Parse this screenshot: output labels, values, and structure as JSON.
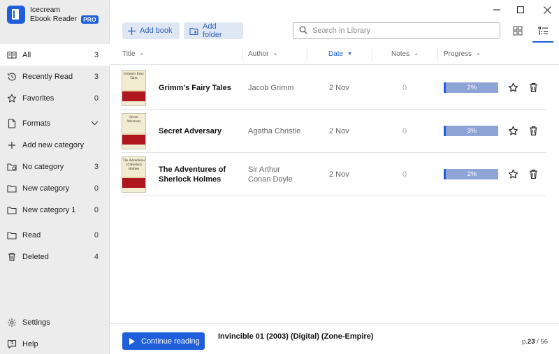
{
  "app": {
    "name_line1": "Icecream",
    "name_line2": "Ebook Reader",
    "badge": "PRO",
    "accent_color": "#1f5fdc"
  },
  "sidebar": {
    "items": [
      {
        "label": "All",
        "count": "3",
        "icon": "book-open-icon",
        "active": true
      },
      {
        "label": "Recently Read",
        "count": "3",
        "icon": "history-icon"
      },
      {
        "label": "Favorites",
        "count": "0",
        "icon": "star-icon"
      },
      {
        "label": "Formats",
        "count": "",
        "icon": "document-icon",
        "expandable": true
      },
      {
        "label": "Add new category",
        "count": "",
        "icon": "plus-icon"
      },
      {
        "label": "No category",
        "count": "3",
        "icon": "folder-icon"
      },
      {
        "label": "New category",
        "count": "0",
        "icon": "folder-icon"
      },
      {
        "label": "New category 1",
        "count": "0",
        "icon": "folder-icon"
      },
      {
        "label": "Read",
        "count": "0",
        "icon": "folder-icon"
      },
      {
        "label": "Deleted",
        "count": "4",
        "icon": "trash-icon"
      }
    ],
    "bottom": [
      {
        "label": "Settings",
        "icon": "gear-icon"
      },
      {
        "label": "Help",
        "icon": "help-icon"
      }
    ]
  },
  "toolbar": {
    "add_book": "Add book",
    "add_folder": "Add folder",
    "search_placeholder": "Search in Library"
  },
  "table": {
    "columns": {
      "title": "Title",
      "author": "Author",
      "date": "Date",
      "notes": "Notes",
      "progress": "Progress"
    },
    "sorted_by": "Date",
    "rows": [
      {
        "title": "Grimm's Fairy Tales",
        "author": "Jacob Grimm",
        "date": "2 Nov",
        "notes": "0",
        "progress": "2%",
        "progress_fraction": 0.02,
        "cover_text": "Grimm's Fairy Tales"
      },
      {
        "title": "Secret Adversary",
        "author": "Agatha Christie",
        "date": "2 Nov",
        "notes": "0",
        "progress": "3%",
        "progress_fraction": 0.03,
        "cover_text": "Secret Adversary"
      },
      {
        "title_line1": "The Adventures of",
        "title_line2": "Sherlock Holmes",
        "author_line1": "Sir Arthur",
        "author_line2": "Conan Doyle",
        "date": "2 Nov",
        "notes": "0",
        "progress": "2%",
        "progress_fraction": 0.02,
        "cover_text": "The Adventures of Sherlock Holmes"
      }
    ]
  },
  "footer": {
    "continue_label": "Continue reading",
    "current_book": "Invincible 01 (2003) (Digital) (Zone-Empire)",
    "page_prefix": "p.",
    "page_current": "23",
    "page_sep": " / ",
    "page_total": "56"
  }
}
